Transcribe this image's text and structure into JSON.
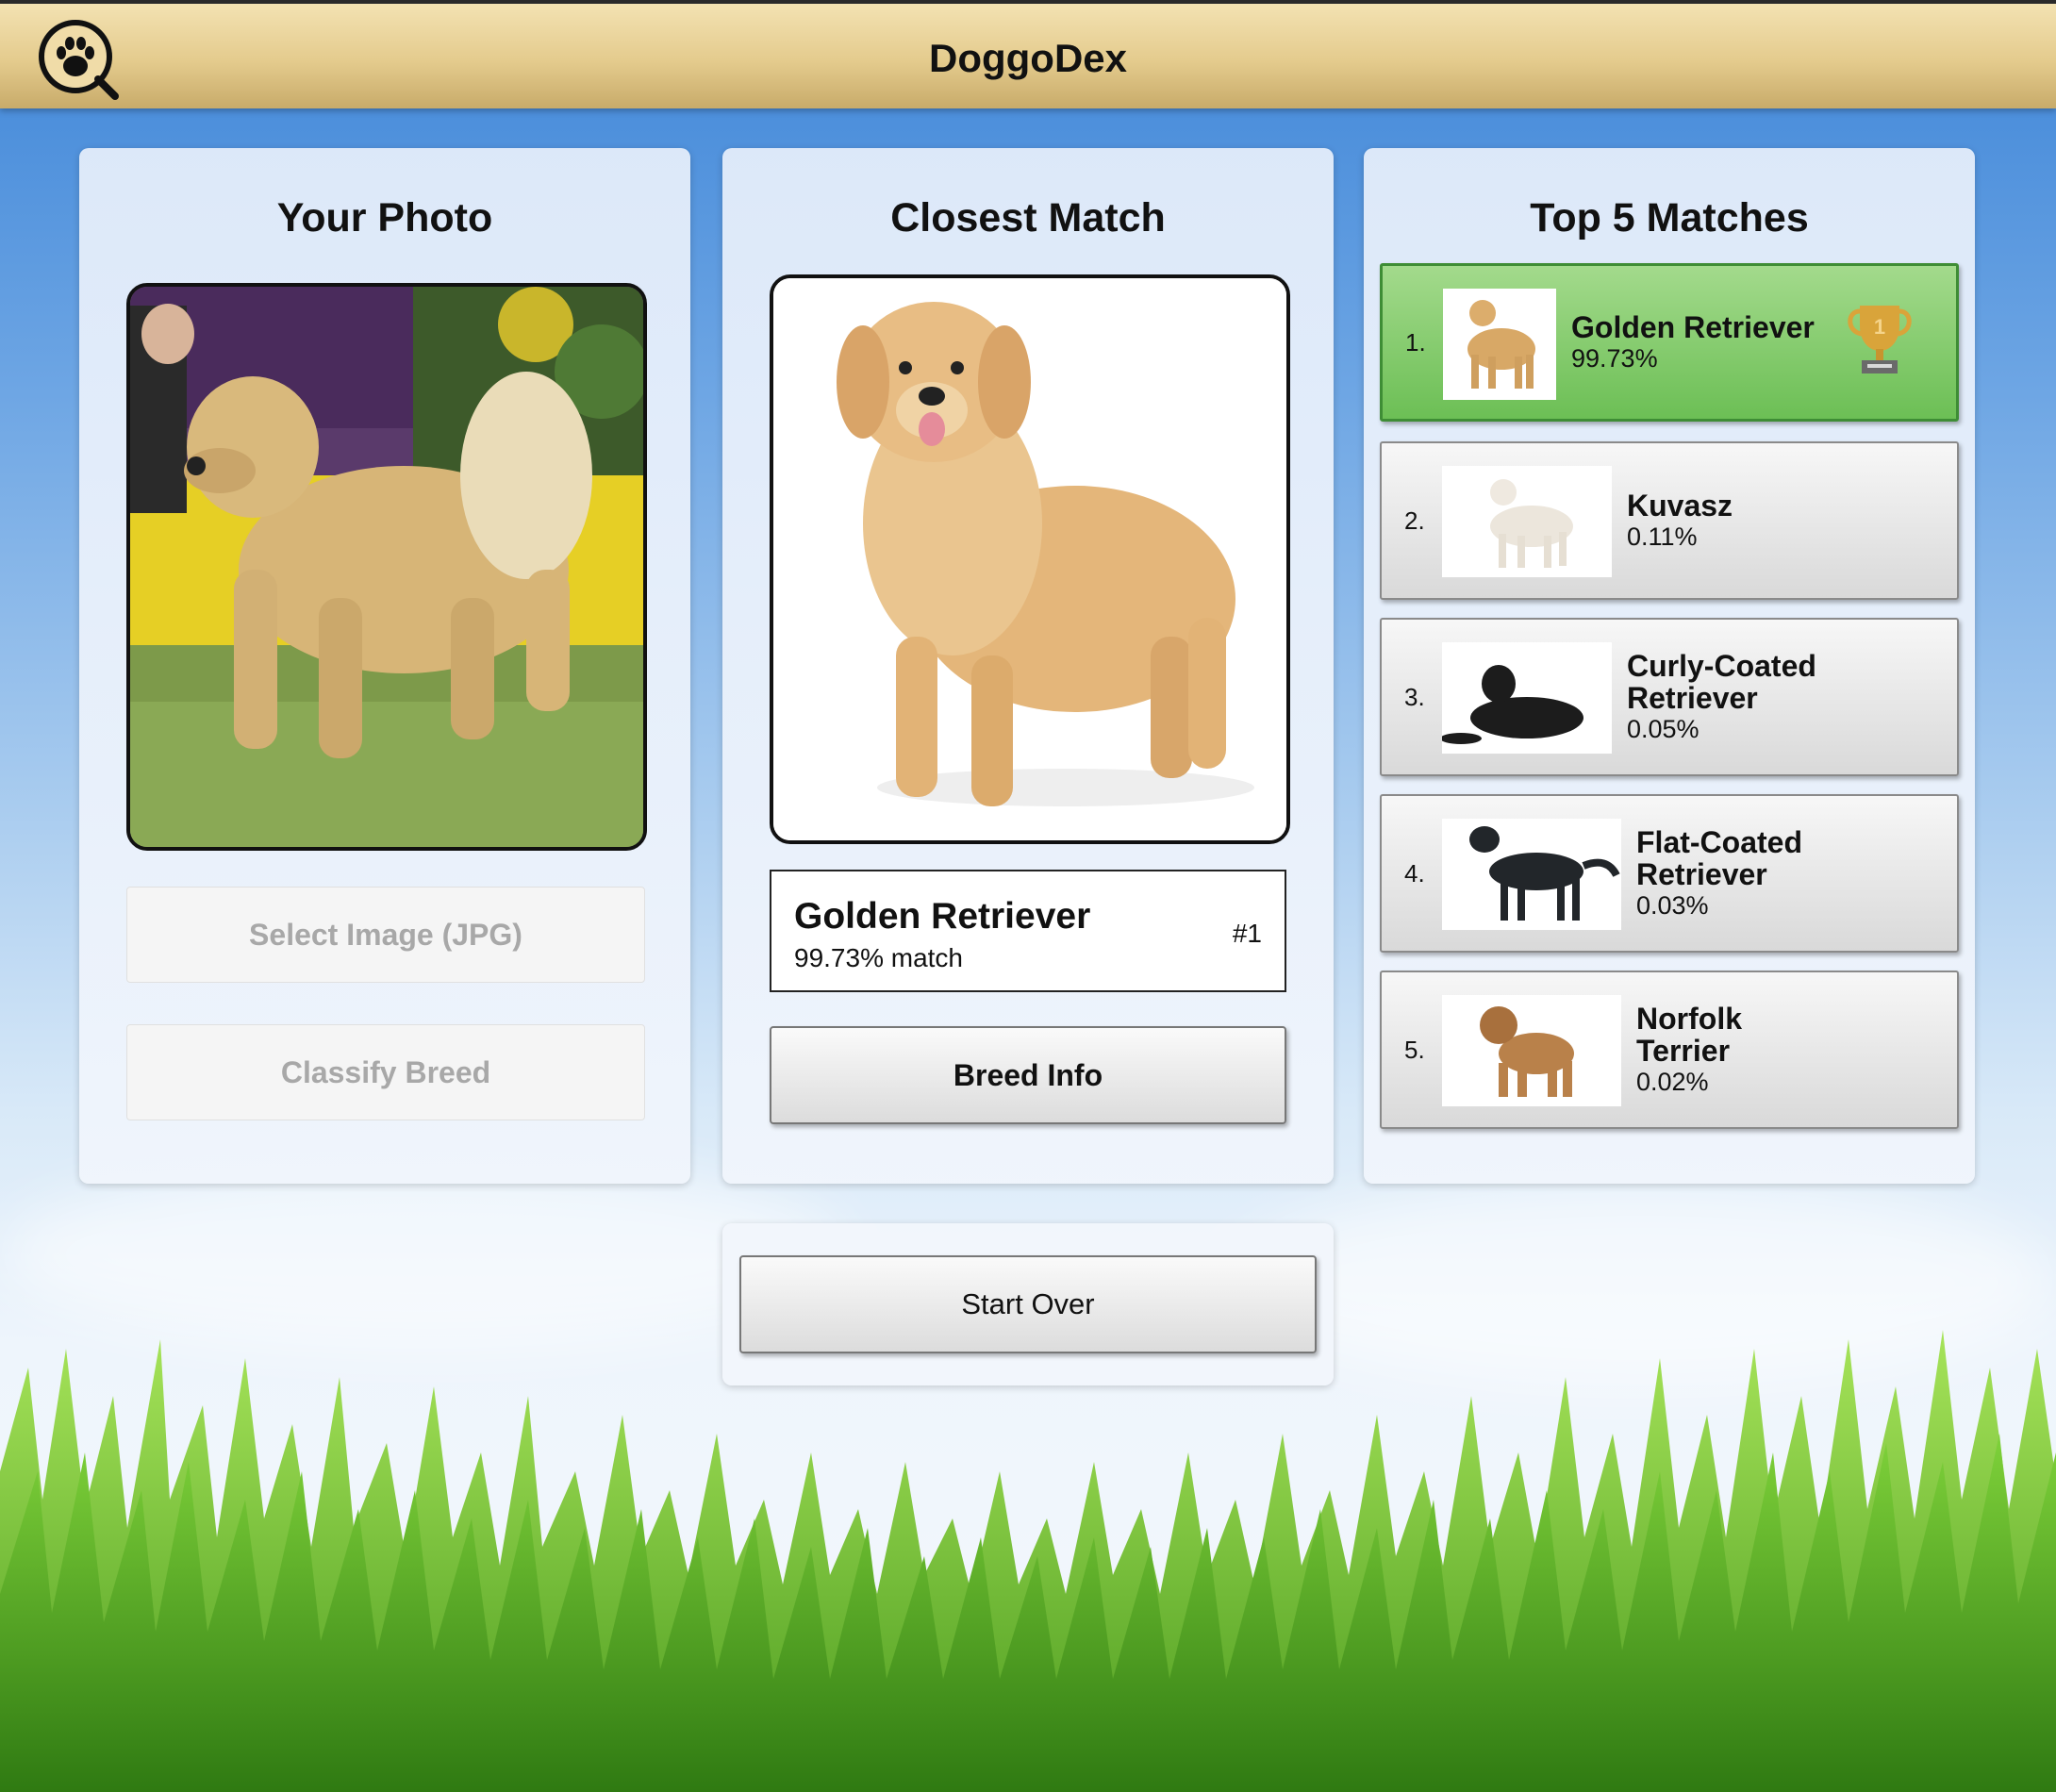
{
  "app": {
    "title": "DoggoDex",
    "logo_icon": "paw-search-icon"
  },
  "colors": {
    "top_match_green": "#6cbf55",
    "header_tan": "#e4cb8d",
    "sky_blue": "#3f86d8"
  },
  "photo_panel": {
    "title": "Your Photo",
    "select_button": "Select Image (JPG)",
    "classify_button": "Classify Breed"
  },
  "match_panel": {
    "title": "Closest Match",
    "breed_name": "Golden Retriever",
    "match_text": "99.73% match",
    "rank": "#1",
    "info_button": "Breed Info"
  },
  "top5_panel": {
    "title": "Top 5 Matches",
    "items": [
      {
        "rank": "1.",
        "name": "Golden Retriever",
        "pct": "99.73%",
        "thumb": "golden-retriever-thumb",
        "badge": "trophy-icon",
        "badge_text": "1"
      },
      {
        "rank": "2.",
        "name": "Kuvasz",
        "pct": "0.11%",
        "thumb": "kuvasz-thumb"
      },
      {
        "rank": "3.",
        "name": "Curly-Coated Retriever",
        "pct": "0.05%",
        "thumb": "curly-coated-retriever-thumb"
      },
      {
        "rank": "4.",
        "name": "Flat-Coated Retriever",
        "pct": "0.03%",
        "thumb": "flat-coated-retriever-thumb"
      },
      {
        "rank": "5.",
        "name": "Norfolk Terrier",
        "pct": "0.02%",
        "thumb": "norfolk-terrier-thumb"
      }
    ]
  },
  "footer": {
    "start_over_button": "Start Over"
  }
}
